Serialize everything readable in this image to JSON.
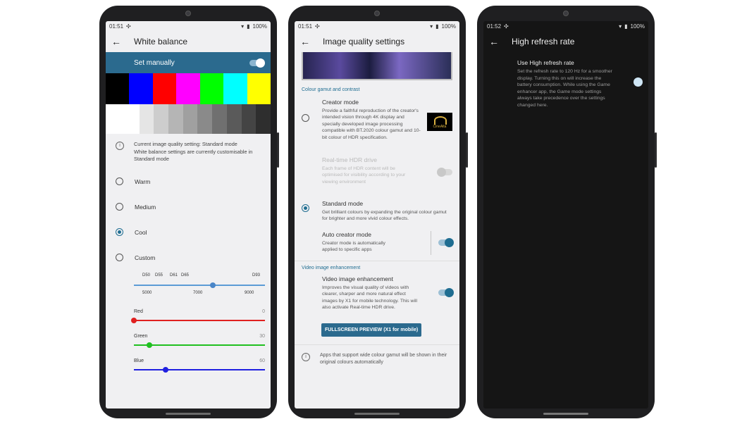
{
  "colors": {
    "accent": "#1f6d91",
    "banner": "#2b6a8e",
    "dark_bg": "#151515",
    "light_bg": "#f0f0f2"
  },
  "phone1": {
    "status": {
      "time": "01:51",
      "battery": "100%"
    },
    "title": "White balance",
    "banner_label": "Set manually",
    "banner_toggle_on": true,
    "color_bars": [
      "#000000",
      "#0000ff",
      "#ff0000",
      "#ff00ff",
      "#00ff00",
      "#00ffff",
      "#ffff00"
    ],
    "gray_bars": [
      "#ffffff",
      "#e5e5e5",
      "#cdcdcd",
      "#b5b5b5",
      "#a0a0a0",
      "#8a8a8a",
      "#707070",
      "#5a5a5a",
      "#444444",
      "#2e2e2e"
    ],
    "info_text": "Current image quality setting: Standard mode\nWhite balance settings are currently customisable in Standard mode",
    "options": [
      {
        "label": "Warm",
        "selected": false
      },
      {
        "label": "Medium",
        "selected": false
      },
      {
        "label": "Cool",
        "selected": true
      },
      {
        "label": "Custom",
        "selected": false
      }
    ],
    "temperature": {
      "presets": [
        "D50",
        "D55",
        "D61",
        "D65",
        "D93"
      ],
      "scale": [
        "5000",
        "7000",
        "9000"
      ],
      "value_fraction": 0.6
    },
    "rgb": [
      {
        "label": "Red",
        "value": "0",
        "color": "#e02020",
        "fraction": 0.0
      },
      {
        "label": "Green",
        "value": "30",
        "color": "#20c020",
        "fraction": 0.12
      },
      {
        "label": "Blue",
        "value": "60",
        "color": "#2020e0",
        "fraction": 0.24
      }
    ]
  },
  "phone2": {
    "status": {
      "time": "01:51",
      "battery": "100%"
    },
    "title": "Image quality settings",
    "section_gamut": "Colour gamut and contrast",
    "creator": {
      "name": "Creator mode",
      "desc": "Provide a faithful reproduction of the creator's intended vision through 4K display and specially developed image processing compatible with BT.2020 colour gamut and 10-bit colour of HDR specification.",
      "logo_text": "CineAlta",
      "selected": false
    },
    "hdr": {
      "name": "Real-time HDR drive",
      "desc": "Each frame of HDR content will be optimised for visibility according to your viewing environment",
      "enabled": false
    },
    "standard": {
      "name": "Standard mode",
      "desc": "Get brilliant colours by expanding the original colour gamut for brighter and more vivid colour effects.",
      "selected": true
    },
    "auto_creator": {
      "name": "Auto creator mode",
      "desc": "Creator mode is automatically applied to specific apps",
      "on": true
    },
    "section_video": "Video image enhancement",
    "video": {
      "name": "Video image enhancement",
      "desc": "Improves the visual quality of videos with clearer, sharper and more natural effect images by X1 for mobile technology. This will also activate Real-time HDR drive.",
      "on": true
    },
    "preview_button": "FULLSCREEN PREVIEW (X1 for mobile)",
    "footnote": "Apps that support wide colour gamut will be shown in their original colours automatically"
  },
  "phone3": {
    "status": {
      "time": "01:52",
      "battery": "100%"
    },
    "title": "High refresh rate",
    "option_name": "Use High refresh rate",
    "option_desc": "Set the refresh rate to 120 Hz for a smoother display. Turning this on will increase the battery consumption. While using the Game enhancer app, the Game mode settings always take precedence over the settings changed here.",
    "on": true
  }
}
